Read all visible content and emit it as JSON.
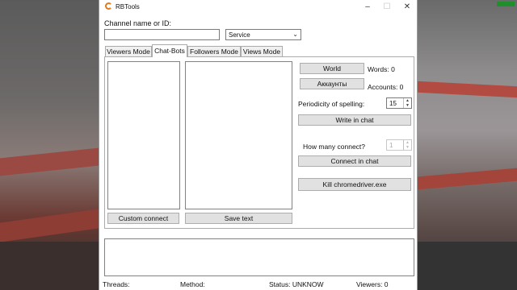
{
  "window": {
    "title": "RBTools",
    "controls": {
      "minimize": "–",
      "maximize": "☐",
      "close": "✕"
    }
  },
  "channel": {
    "label": "Channel name or ID:",
    "value": "",
    "service_value": "Service"
  },
  "tabs": [
    {
      "label": "Viewers Mode",
      "active": false
    },
    {
      "label": "Chat-Bots",
      "active": true
    },
    {
      "label": "Followers Mode",
      "active": false
    },
    {
      "label": "Views Mode",
      "active": false
    }
  ],
  "chatbots": {
    "custom_connect_label": "Custom connect",
    "save_text_label": "Save text",
    "world_label": "World",
    "words_text": "Words: 0",
    "accounts_button_label": "Аккаунты",
    "accounts_text": "Accounts: 0",
    "periodicity_label": "Periodicity of spelling:",
    "periodicity_value": "15",
    "write_in_chat_label": "Write in chat",
    "how_many_label": "How many connect?",
    "how_many_value": "1",
    "connect_in_chat_label": "Connect in chat",
    "kill_label": "Kill chromedriver.exe"
  },
  "statusbar": {
    "threads": "Threads:",
    "method": "Method:",
    "status": "Status: UNKNOW",
    "viewers": "Viewers: 0"
  },
  "overlay": {
    "fps_color": "#1e8f2a"
  },
  "colors": {
    "accent": "#e07a1a"
  }
}
